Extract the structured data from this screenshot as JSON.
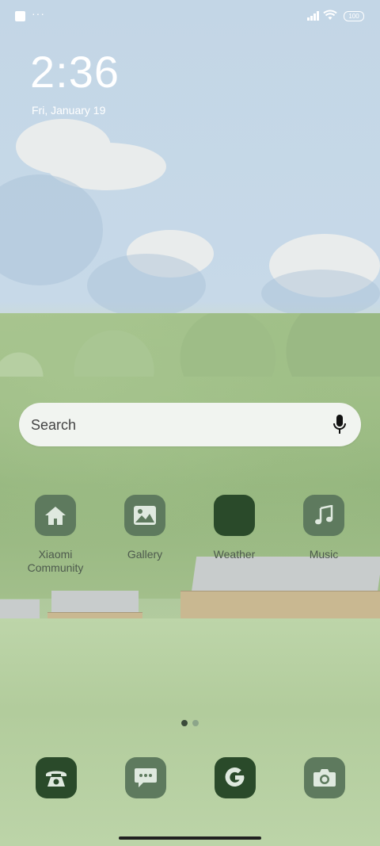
{
  "status_bar": {
    "indicator": "···",
    "battery": "100"
  },
  "lock": {
    "time": "2:36",
    "date": "Fri, January 19"
  },
  "search": {
    "label": "Search"
  },
  "apps": [
    {
      "label": "Xiaomi Community",
      "icon": "home-icon"
    },
    {
      "label": "Gallery",
      "icon": "image-icon"
    },
    {
      "label": "Weather",
      "icon": "blank-icon"
    },
    {
      "label": "Music",
      "icon": "music-note-icon"
    }
  ],
  "dock": [
    {
      "icon": "phone-icon"
    },
    {
      "icon": "message-icon"
    },
    {
      "icon": "google-icon"
    },
    {
      "icon": "camera-icon"
    }
  ],
  "pager": {
    "current_page": 1,
    "page_count": 2
  },
  "colors": {
    "icon_light_bg": "#5e7a5e",
    "icon_dark_bg": "#2a4a2a",
    "glyph": "#dfe9df"
  }
}
